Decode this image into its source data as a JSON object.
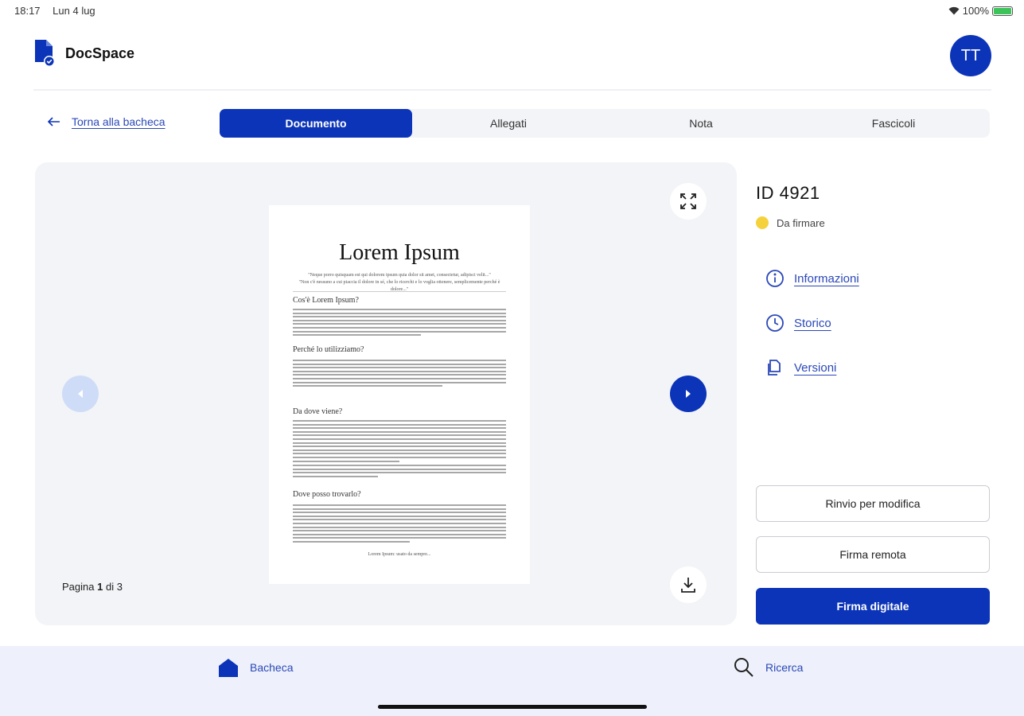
{
  "status_bar": {
    "time": "18:17",
    "date": "Lun 4 lug",
    "battery": "100%",
    "battery_level": 1.0
  },
  "header": {
    "app_name": "DocSpace",
    "avatar_initials": "TT"
  },
  "nav": {
    "back_label": "Torna alla bacheca"
  },
  "tabs": [
    {
      "label": "Documento",
      "active": true
    },
    {
      "label": "Allegati",
      "active": false
    },
    {
      "label": "Nota",
      "active": false
    },
    {
      "label": "Fascicoli",
      "active": false
    }
  ],
  "viewer": {
    "page_label": "Pagina",
    "current_page": "1",
    "page_sep": "di",
    "total_pages": "3",
    "document": {
      "title": "Lorem Ipsum",
      "subtitle_1": "\"Neque porro quisquam est qui dolorem ipsum quia dolor sit amet, consectetur, adipisci velit...\"",
      "subtitle_2": "\"Non c'è nessuno a cui piaccia il dolore in sé, che lo ricerchi e lo voglia ottenere, semplicemente perché è dolore...\"",
      "headings": [
        "Cos'è Lorem Ipsum?",
        "Perché lo utilizziamo?",
        "Da dove viene?",
        "Dove posso trovarlo?"
      ],
      "footer": "Lorem Ipsum: usato da sempre..."
    }
  },
  "side": {
    "doc_id": "ID 4921",
    "status": "Da firmare",
    "status_color": "#f5d23c",
    "links": [
      {
        "label": "Informazioni",
        "icon": "info-icon"
      },
      {
        "label": "Storico",
        "icon": "clock-icon"
      },
      {
        "label": "Versioni",
        "icon": "copy-icon"
      }
    ],
    "actions": {
      "rinvio": "Rinvio per modifica",
      "firma_remota": "Firma remota",
      "firma_digitale": "Firma digitale"
    }
  },
  "bottom_nav": {
    "bacheca": "Bacheca",
    "ricerca": "Ricerca"
  },
  "colors": {
    "primary": "#0c34b8",
    "surface": "#f2f4f7",
    "bottom_bar": "#eef1fb"
  }
}
